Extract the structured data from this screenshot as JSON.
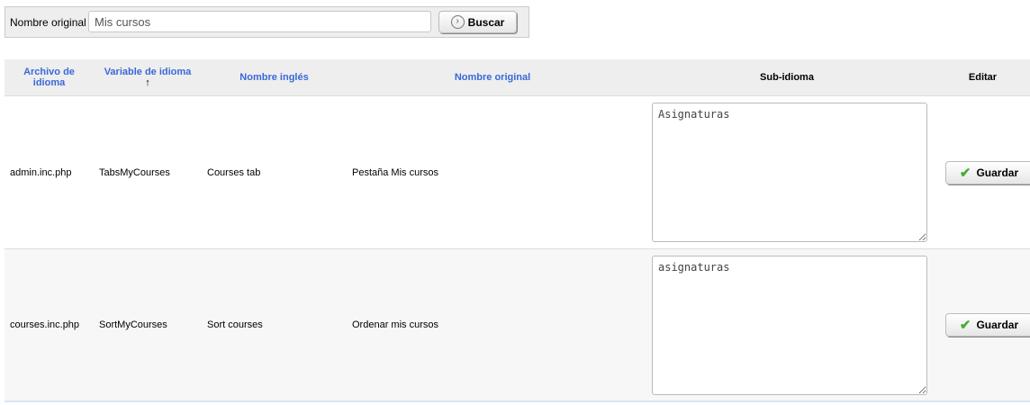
{
  "search": {
    "label": "Nombre original :",
    "value": "Mis cursos",
    "button_label": "Buscar",
    "button_icon": "arrow-right-circle-icon"
  },
  "table": {
    "headers": {
      "file": "Archivo de idioma",
      "variable": "Variable de idioma",
      "sort_arrow": "↑",
      "english": "Nombre inglés",
      "original": "Nombre original",
      "sublanguage": "Sub-idioma",
      "edit": "Editar"
    },
    "rows": [
      {
        "file": "admin.inc.php",
        "variable": "TabsMyCourses",
        "english": "Courses tab",
        "original": "Pestaña Mis cursos",
        "sublanguage": "Asignaturas",
        "save_label": "Guardar"
      },
      {
        "file": "courses.inc.php",
        "variable": "SortMyCourses",
        "english": "Sort courses",
        "original": "Ordenar mis cursos",
        "sublanguage": "asignaturas",
        "save_label": "Guardar"
      }
    ]
  },
  "colors": {
    "header_link": "#3a68d9",
    "header_bg": "#eeeeee",
    "save_check": "#4caa3a"
  }
}
